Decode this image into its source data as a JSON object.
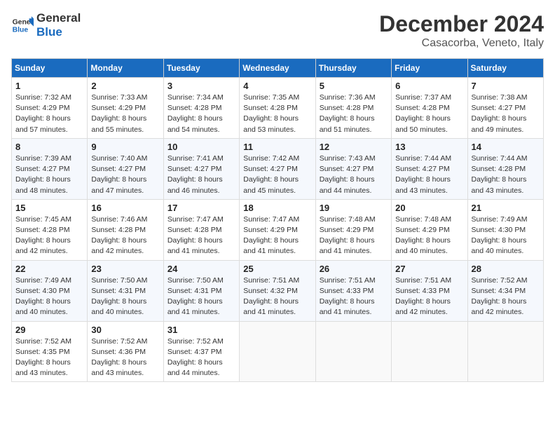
{
  "header": {
    "logo_line1": "General",
    "logo_line2": "Blue",
    "month": "December 2024",
    "location": "Casacorba, Veneto, Italy"
  },
  "weekdays": [
    "Sunday",
    "Monday",
    "Tuesday",
    "Wednesday",
    "Thursday",
    "Friday",
    "Saturday"
  ],
  "weeks": [
    [
      {
        "day": "1",
        "text": "Sunrise: 7:32 AM\nSunset: 4:29 PM\nDaylight: 8 hours\nand 57 minutes."
      },
      {
        "day": "2",
        "text": "Sunrise: 7:33 AM\nSunset: 4:29 PM\nDaylight: 8 hours\nand 55 minutes."
      },
      {
        "day": "3",
        "text": "Sunrise: 7:34 AM\nSunset: 4:28 PM\nDaylight: 8 hours\nand 54 minutes."
      },
      {
        "day": "4",
        "text": "Sunrise: 7:35 AM\nSunset: 4:28 PM\nDaylight: 8 hours\nand 53 minutes."
      },
      {
        "day": "5",
        "text": "Sunrise: 7:36 AM\nSunset: 4:28 PM\nDaylight: 8 hours\nand 51 minutes."
      },
      {
        "day": "6",
        "text": "Sunrise: 7:37 AM\nSunset: 4:28 PM\nDaylight: 8 hours\nand 50 minutes."
      },
      {
        "day": "7",
        "text": "Sunrise: 7:38 AM\nSunset: 4:27 PM\nDaylight: 8 hours\nand 49 minutes."
      }
    ],
    [
      {
        "day": "8",
        "text": "Sunrise: 7:39 AM\nSunset: 4:27 PM\nDaylight: 8 hours\nand 48 minutes."
      },
      {
        "day": "9",
        "text": "Sunrise: 7:40 AM\nSunset: 4:27 PM\nDaylight: 8 hours\nand 47 minutes."
      },
      {
        "day": "10",
        "text": "Sunrise: 7:41 AM\nSunset: 4:27 PM\nDaylight: 8 hours\nand 46 minutes."
      },
      {
        "day": "11",
        "text": "Sunrise: 7:42 AM\nSunset: 4:27 PM\nDaylight: 8 hours\nand 45 minutes."
      },
      {
        "day": "12",
        "text": "Sunrise: 7:43 AM\nSunset: 4:27 PM\nDaylight: 8 hours\nand 44 minutes."
      },
      {
        "day": "13",
        "text": "Sunrise: 7:44 AM\nSunset: 4:27 PM\nDaylight: 8 hours\nand 43 minutes."
      },
      {
        "day": "14",
        "text": "Sunrise: 7:44 AM\nSunset: 4:28 PM\nDaylight: 8 hours\nand 43 minutes."
      }
    ],
    [
      {
        "day": "15",
        "text": "Sunrise: 7:45 AM\nSunset: 4:28 PM\nDaylight: 8 hours\nand 42 minutes."
      },
      {
        "day": "16",
        "text": "Sunrise: 7:46 AM\nSunset: 4:28 PM\nDaylight: 8 hours\nand 42 minutes."
      },
      {
        "day": "17",
        "text": "Sunrise: 7:47 AM\nSunset: 4:28 PM\nDaylight: 8 hours\nand 41 minutes."
      },
      {
        "day": "18",
        "text": "Sunrise: 7:47 AM\nSunset: 4:29 PM\nDaylight: 8 hours\nand 41 minutes."
      },
      {
        "day": "19",
        "text": "Sunrise: 7:48 AM\nSunset: 4:29 PM\nDaylight: 8 hours\nand 41 minutes."
      },
      {
        "day": "20",
        "text": "Sunrise: 7:48 AM\nSunset: 4:29 PM\nDaylight: 8 hours\nand 40 minutes."
      },
      {
        "day": "21",
        "text": "Sunrise: 7:49 AM\nSunset: 4:30 PM\nDaylight: 8 hours\nand 40 minutes."
      }
    ],
    [
      {
        "day": "22",
        "text": "Sunrise: 7:49 AM\nSunset: 4:30 PM\nDaylight: 8 hours\nand 40 minutes."
      },
      {
        "day": "23",
        "text": "Sunrise: 7:50 AM\nSunset: 4:31 PM\nDaylight: 8 hours\nand 40 minutes."
      },
      {
        "day": "24",
        "text": "Sunrise: 7:50 AM\nSunset: 4:31 PM\nDaylight: 8 hours\nand 41 minutes."
      },
      {
        "day": "25",
        "text": "Sunrise: 7:51 AM\nSunset: 4:32 PM\nDaylight: 8 hours\nand 41 minutes."
      },
      {
        "day": "26",
        "text": "Sunrise: 7:51 AM\nSunset: 4:33 PM\nDaylight: 8 hours\nand 41 minutes."
      },
      {
        "day": "27",
        "text": "Sunrise: 7:51 AM\nSunset: 4:33 PM\nDaylight: 8 hours\nand 42 minutes."
      },
      {
        "day": "28",
        "text": "Sunrise: 7:52 AM\nSunset: 4:34 PM\nDaylight: 8 hours\nand 42 minutes."
      }
    ],
    [
      {
        "day": "29",
        "text": "Sunrise: 7:52 AM\nSunset: 4:35 PM\nDaylight: 8 hours\nand 43 minutes."
      },
      {
        "day": "30",
        "text": "Sunrise: 7:52 AM\nSunset: 4:36 PM\nDaylight: 8 hours\nand 43 minutes."
      },
      {
        "day": "31",
        "text": "Sunrise: 7:52 AM\nSunset: 4:37 PM\nDaylight: 8 hours\nand 44 minutes."
      },
      {
        "day": "",
        "text": ""
      },
      {
        "day": "",
        "text": ""
      },
      {
        "day": "",
        "text": ""
      },
      {
        "day": "",
        "text": ""
      }
    ]
  ]
}
